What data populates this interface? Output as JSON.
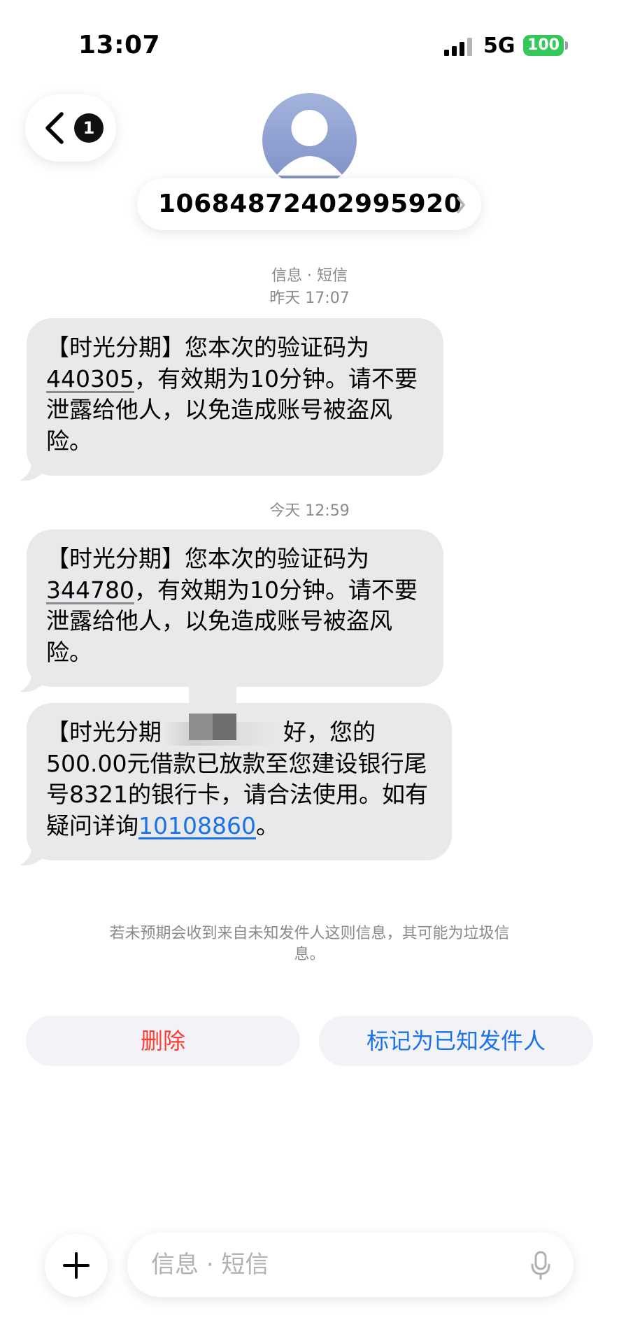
{
  "status_bar": {
    "time": "13:07",
    "network": "5G",
    "battery": "100",
    "icons": [
      "signal-icon",
      "battery-icon"
    ]
  },
  "header": {
    "back_badge": "1",
    "sender": "10684872402995920",
    "icons": [
      "chevron-left-icon",
      "contact-avatar-icon",
      "chevron-right-icon"
    ]
  },
  "thread": {
    "service_label": "信息 · 短信",
    "timestamp_1": "昨天 17:07",
    "timestamp_2": "今天 12:59"
  },
  "messages": [
    {
      "pre": "【时光分期】您本次的验证码为",
      "code": "440305",
      "post": "，有效期为10分钟。请不要泄露给他人，以免造成账号被盗风险。"
    },
    {
      "pre": "【时光分期】您本次的验证码为",
      "code": "344780",
      "post": "，有效期为10分钟。请不要泄露给他人，以免造成账号被盗风险。"
    },
    {
      "pre": "【时光分期",
      "mid": "好，您的500.00元借款已放款至您建设银行尾号8321的银行卡，请合法使用。如有疑问详询",
      "link": "10108860",
      "post": "。"
    }
  ],
  "notice": {
    "text": "若未预期会收到来自未知发件人这则信息，其可能为垃圾信息。"
  },
  "actions": {
    "delete": "删除",
    "mark_known": "标记为已知发件人"
  },
  "composer": {
    "placeholder": "信息 · 短信",
    "icons": [
      "plus-icon",
      "microphone-icon"
    ]
  },
  "colors": {
    "bubble": "#e9e9eb",
    "link": "#1a73e8",
    "delete": "#ff3b30",
    "battery": "#34c759"
  }
}
